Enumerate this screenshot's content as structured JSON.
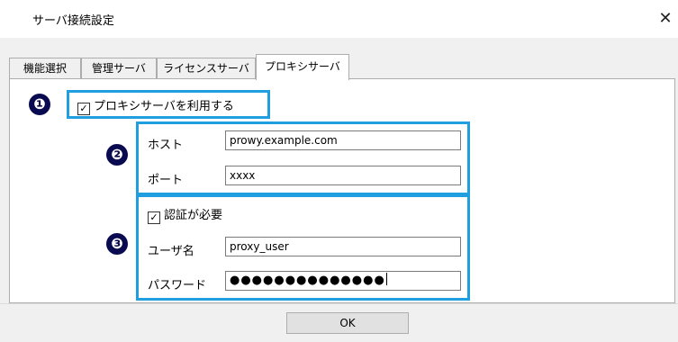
{
  "window": {
    "title": "サーバ接続設定",
    "close_icon": "close-icon"
  },
  "tabs": [
    {
      "label": "機能選択",
      "active": false
    },
    {
      "label": "管理サーバ",
      "active": false
    },
    {
      "label": "ライセンスサーバ",
      "active": false
    },
    {
      "label": "プロキシサーバ",
      "active": true
    }
  ],
  "callouts": {
    "one": "❶",
    "two": "❷",
    "three": "❸"
  },
  "proxy": {
    "use_proxy_label": "プロキシサーバを利用する",
    "use_proxy_checked": true,
    "host_label": "ホスト",
    "host_value": "prowy.example.com",
    "port_label": "ポート",
    "port_value": "xxxx"
  },
  "auth": {
    "require_label": "認証が必要",
    "require_checked": true,
    "username_label": "ユーザ名",
    "username_value": "proxy_user",
    "password_label": "パスワード",
    "password_value": "●●●●●●●●●●●●●●"
  },
  "footer": {
    "ok_label": "OK"
  },
  "colors": {
    "highlight": "#1f9fe0",
    "badge": "#0a0a50"
  }
}
